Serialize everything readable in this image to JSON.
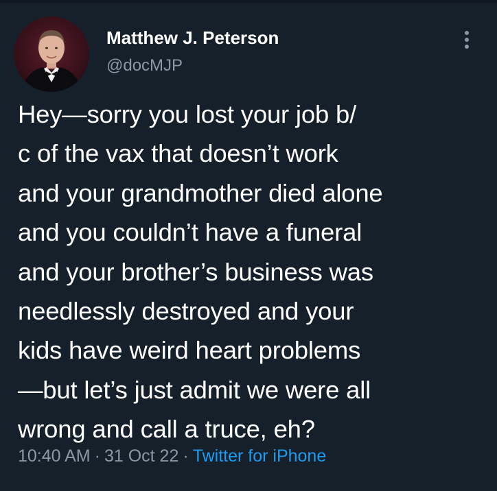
{
  "tweet": {
    "author": {
      "display_name": "Matthew J. Peterson",
      "handle": "@docMJP"
    },
    "text_lines": [
      "Hey—sorry you lost your job b/",
      "c of the vax that doesn’t work",
      "and your grandmother died alone",
      "and you couldn’t have a funeral",
      "and your brother’s business was",
      "needlessly destroyed and your",
      "kids have weird heart problems",
      "—but let’s just admit we were all",
      "wrong and call a truce, eh?"
    ],
    "time": "10:40 AM",
    "separator": "·",
    "date": "31 Oct 22",
    "source": "Twitter for iPhone"
  },
  "colors": {
    "background": "#15202b",
    "primary_text": "#ffffff",
    "secondary_text": "#8b98a5",
    "link": "#1d9bf0"
  },
  "icons": {
    "more": "more-vertical-icon"
  }
}
